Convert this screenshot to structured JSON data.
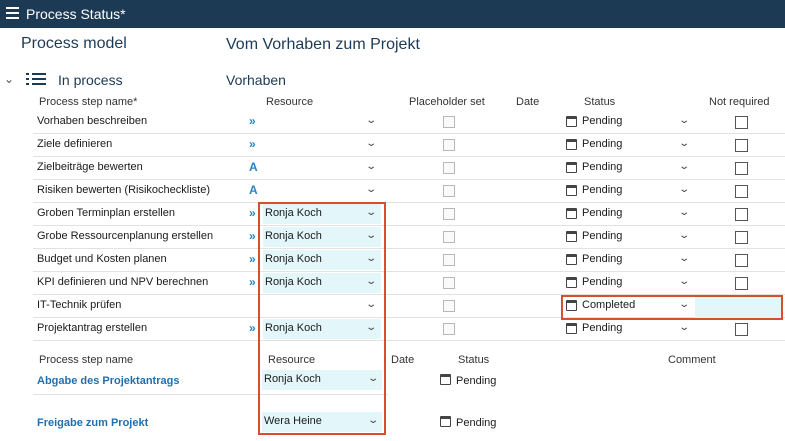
{
  "window": {
    "title": "Process Status*"
  },
  "process": {
    "model_label": "Process model",
    "model_name": "Vom Vorhaben zum Projekt"
  },
  "phase": {
    "status_label": "In process",
    "name": "Vorhaben"
  },
  "steps_headers": {
    "name": "Process step name*",
    "resource": "Resource",
    "placeholder": "Placeholder set",
    "date": "Date",
    "status": "Status",
    "not_required": "Not required"
  },
  "steps": [
    {
      "name": "Vorhaben beschreiben",
      "marker": "»",
      "resource": "",
      "status": "Pending",
      "not_required": false
    },
    {
      "name": "Ziele definieren",
      "marker": "»",
      "resource": "",
      "status": "Pending",
      "not_required": false
    },
    {
      "name": "Zielbeiträge bewerten",
      "marker": "A",
      "resource": "",
      "status": "Pending",
      "not_required": false
    },
    {
      "name": "Risiken bewerten (Risikocheckliste)",
      "marker": "A",
      "resource": "",
      "status": "Pending",
      "not_required": false
    },
    {
      "name": "Groben Terminplan erstellen",
      "marker": "»",
      "resource": "Ronja Koch",
      "status": "Pending",
      "not_required": false
    },
    {
      "name": "Grobe Ressourcenplanung erstellen",
      "marker": "»",
      "resource": "Ronja Koch",
      "status": "Pending",
      "not_required": false
    },
    {
      "name": "Budget und Kosten planen",
      "marker": "»",
      "resource": "Ronja Koch",
      "status": "Pending",
      "not_required": false
    },
    {
      "name": "KPI definieren und NPV berechnen",
      "marker": "»",
      "resource": "Ronja Koch",
      "status": "Pending",
      "not_required": false
    },
    {
      "name": "IT-Technik prüfen",
      "marker": "",
      "resource": "",
      "status": "Completed",
      "not_required": true
    },
    {
      "name": "Projektantrag erstellen",
      "marker": "»",
      "resource": "Ronja Koch",
      "status": "Pending",
      "not_required": false
    }
  ],
  "milestone_headers": {
    "name": "Process step name",
    "resource": "Resource",
    "date": "Date",
    "status": "Status",
    "comment": "Comment"
  },
  "milestones": [
    {
      "name": "Abgabe des Projektantrags",
      "resource": "Ronja Koch",
      "status": "Pending"
    },
    {
      "name": "Freigabe zum Projekt",
      "resource": "Wera Heine",
      "status": "Pending"
    }
  ],
  "colors": {
    "header_bg": "#1d3a55",
    "link_blue": "#1f6fb0",
    "highlight": "#d4502f",
    "cell_tint": "#e3f7fb"
  }
}
